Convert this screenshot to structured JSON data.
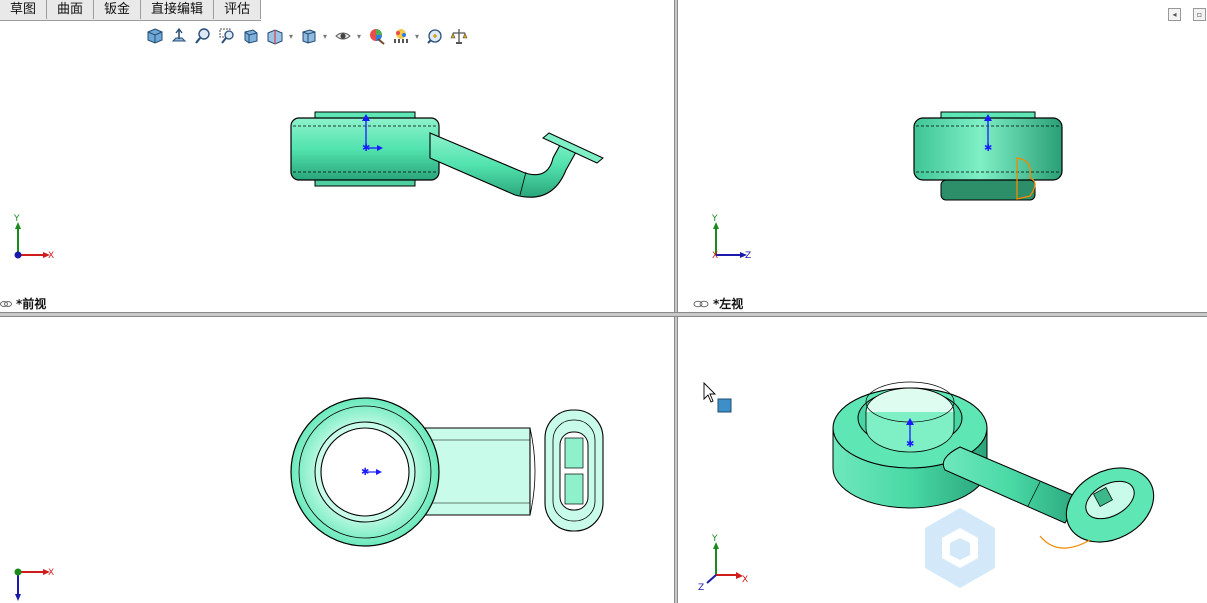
{
  "menu_tabs": [
    "草图",
    "曲面",
    "钣金",
    "直接编辑",
    "评估"
  ],
  "hud_icons": [
    "view-orientation-cube-icon",
    "normal-to-icon",
    "zoom-to-fit-icon",
    "zoom-to-area-icon",
    "previous-view-icon",
    "section-view-icon",
    "display-style-icon",
    "hide-show-items-icon",
    "edit-appearance-icon",
    "apply-scene-icon",
    "view-settings-icon",
    "measure-icon"
  ],
  "viewports": {
    "front": {
      "label": "*前视",
      "axes": {
        "a": "Y",
        "b": "X"
      }
    },
    "left": {
      "label": "*左视",
      "axes": {
        "a": "Y",
        "b": "Z",
        "c": "X"
      }
    },
    "top": {
      "axes": {
        "a": "X"
      }
    },
    "iso": {
      "axes": {
        "a": "Y",
        "b": "X",
        "c": "Z"
      }
    }
  },
  "colors": {
    "part_fill": "#52e3ae",
    "part_dark": "#1f8c68",
    "accent_blue": "#1a1aff",
    "highlight_orange": "#f08a00",
    "split_gray": "#c9c9c9"
  }
}
